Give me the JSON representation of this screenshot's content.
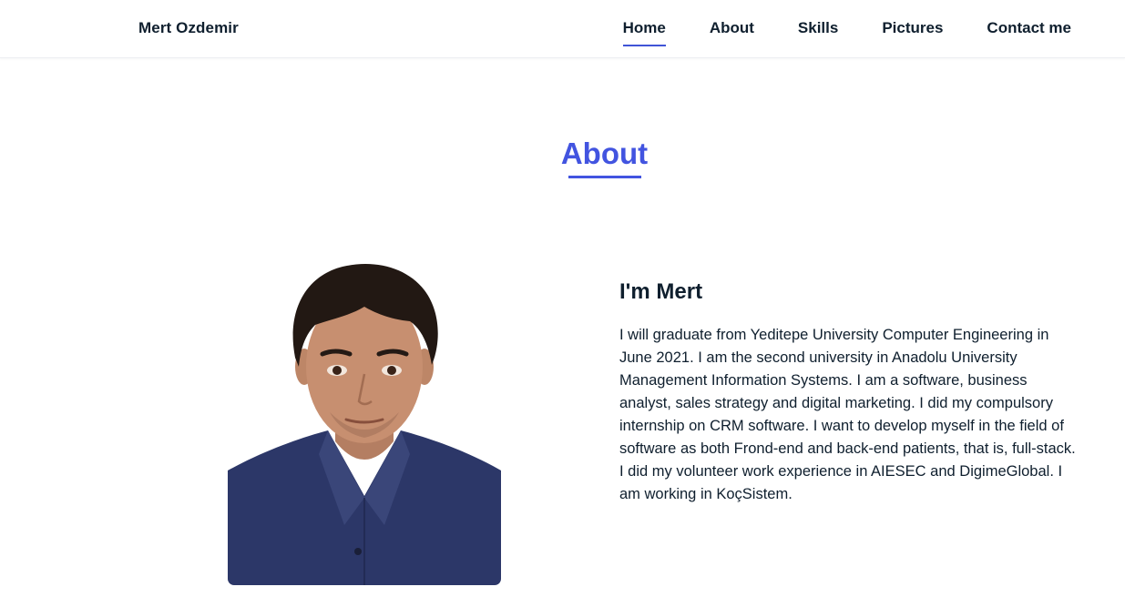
{
  "header": {
    "brand": "Mert Ozdemir",
    "nav": [
      {
        "label": "Home",
        "active": true
      },
      {
        "label": "About",
        "active": false
      },
      {
        "label": "Skills",
        "active": false
      },
      {
        "label": "Pictures",
        "active": false
      },
      {
        "label": "Contact me",
        "active": false
      }
    ]
  },
  "about": {
    "section_title": "About",
    "subtitle": "I'm Mert",
    "description": "I will graduate from Yeditepe University Computer Engineering in June 2021. I am the second university in Anadolu University Management Information Systems. I am a software, business analyst, sales strategy and digital marketing. I did my compulsory internship on CRM software. I want to develop myself in the field of software as both Frond-end and back-end patients, that is, full-stack. I did my volunteer work experience in AIESEC and DigimeGlobal. I am working in KoçSistem.",
    "photo_icon": "profile-photo"
  },
  "colors": {
    "accent": "#4254e0",
    "text": "#0f1f2e",
    "background": "#ffffff"
  }
}
